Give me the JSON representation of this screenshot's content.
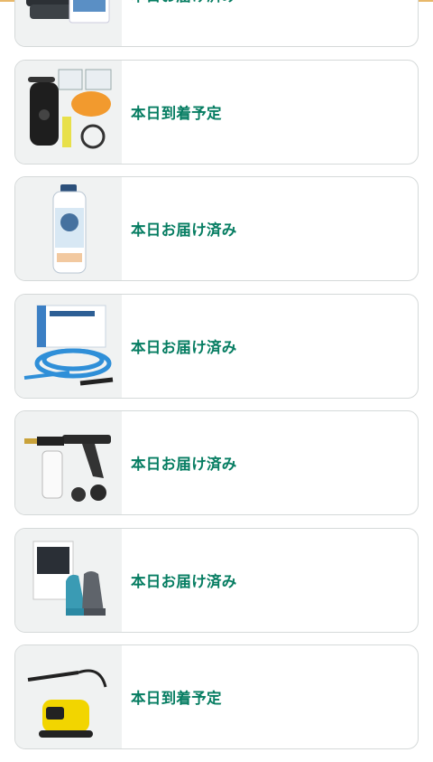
{
  "orders": [
    {
      "status": "本日お届け済み",
      "product_icon": "microfiber-towel-icon"
    },
    {
      "status": "本日到着予定",
      "product_icon": "water-filter-kit-icon"
    },
    {
      "status": "本日お届け済み",
      "product_icon": "car-shampoo-bottle-icon"
    },
    {
      "status": "本日お届け済み",
      "product_icon": "pressure-washer-hose-icon"
    },
    {
      "status": "本日お届け済み",
      "product_icon": "foam-spray-gun-icon"
    },
    {
      "status": "本日お届け済み",
      "product_icon": "wash-mitt-icon"
    },
    {
      "status": "本日到着予定",
      "product_icon": "pressure-washer-icon"
    }
  ],
  "colors": {
    "status_text": "#067d62",
    "card_border": "#d5d9d9",
    "thumb_bg": "#f0f2f2",
    "accent": "#e8b86a"
  }
}
